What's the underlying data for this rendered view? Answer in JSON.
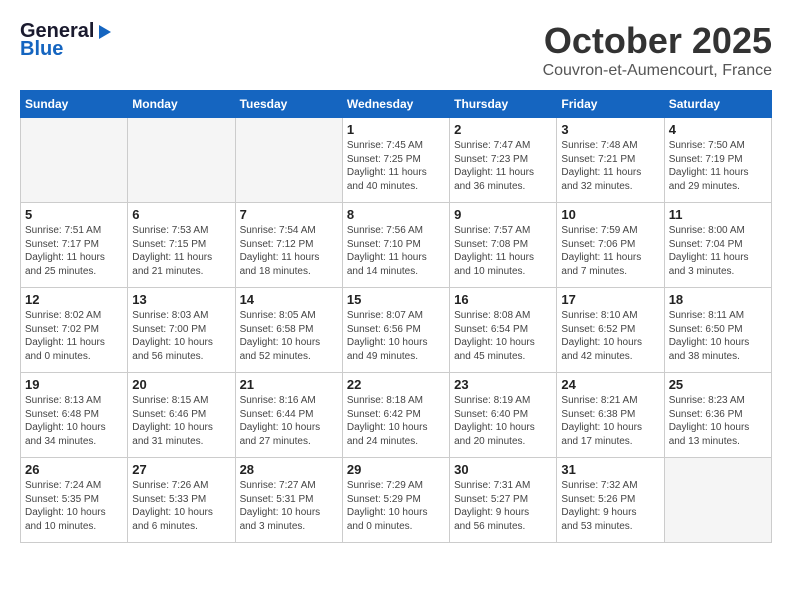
{
  "header": {
    "logo_general": "General",
    "logo_blue": "Blue",
    "month": "October 2025",
    "location": "Couvron-et-Aumencourt, France"
  },
  "weekdays": [
    "Sunday",
    "Monday",
    "Tuesday",
    "Wednesday",
    "Thursday",
    "Friday",
    "Saturday"
  ],
  "weeks": [
    [
      {
        "day": "",
        "info": ""
      },
      {
        "day": "",
        "info": ""
      },
      {
        "day": "",
        "info": ""
      },
      {
        "day": "1",
        "info": "Sunrise: 7:45 AM\nSunset: 7:25 PM\nDaylight: 11 hours\nand 40 minutes."
      },
      {
        "day": "2",
        "info": "Sunrise: 7:47 AM\nSunset: 7:23 PM\nDaylight: 11 hours\nand 36 minutes."
      },
      {
        "day": "3",
        "info": "Sunrise: 7:48 AM\nSunset: 7:21 PM\nDaylight: 11 hours\nand 32 minutes."
      },
      {
        "day": "4",
        "info": "Sunrise: 7:50 AM\nSunset: 7:19 PM\nDaylight: 11 hours\nand 29 minutes."
      }
    ],
    [
      {
        "day": "5",
        "info": "Sunrise: 7:51 AM\nSunset: 7:17 PM\nDaylight: 11 hours\nand 25 minutes."
      },
      {
        "day": "6",
        "info": "Sunrise: 7:53 AM\nSunset: 7:15 PM\nDaylight: 11 hours\nand 21 minutes."
      },
      {
        "day": "7",
        "info": "Sunrise: 7:54 AM\nSunset: 7:12 PM\nDaylight: 11 hours\nand 18 minutes."
      },
      {
        "day": "8",
        "info": "Sunrise: 7:56 AM\nSunset: 7:10 PM\nDaylight: 11 hours\nand 14 minutes."
      },
      {
        "day": "9",
        "info": "Sunrise: 7:57 AM\nSunset: 7:08 PM\nDaylight: 11 hours\nand 10 minutes."
      },
      {
        "day": "10",
        "info": "Sunrise: 7:59 AM\nSunset: 7:06 PM\nDaylight: 11 hours\nand 7 minutes."
      },
      {
        "day": "11",
        "info": "Sunrise: 8:00 AM\nSunset: 7:04 PM\nDaylight: 11 hours\nand 3 minutes."
      }
    ],
    [
      {
        "day": "12",
        "info": "Sunrise: 8:02 AM\nSunset: 7:02 PM\nDaylight: 11 hours\nand 0 minutes."
      },
      {
        "day": "13",
        "info": "Sunrise: 8:03 AM\nSunset: 7:00 PM\nDaylight: 10 hours\nand 56 minutes."
      },
      {
        "day": "14",
        "info": "Sunrise: 8:05 AM\nSunset: 6:58 PM\nDaylight: 10 hours\nand 52 minutes."
      },
      {
        "day": "15",
        "info": "Sunrise: 8:07 AM\nSunset: 6:56 PM\nDaylight: 10 hours\nand 49 minutes."
      },
      {
        "day": "16",
        "info": "Sunrise: 8:08 AM\nSunset: 6:54 PM\nDaylight: 10 hours\nand 45 minutes."
      },
      {
        "day": "17",
        "info": "Sunrise: 8:10 AM\nSunset: 6:52 PM\nDaylight: 10 hours\nand 42 minutes."
      },
      {
        "day": "18",
        "info": "Sunrise: 8:11 AM\nSunset: 6:50 PM\nDaylight: 10 hours\nand 38 minutes."
      }
    ],
    [
      {
        "day": "19",
        "info": "Sunrise: 8:13 AM\nSunset: 6:48 PM\nDaylight: 10 hours\nand 34 minutes."
      },
      {
        "day": "20",
        "info": "Sunrise: 8:15 AM\nSunset: 6:46 PM\nDaylight: 10 hours\nand 31 minutes."
      },
      {
        "day": "21",
        "info": "Sunrise: 8:16 AM\nSunset: 6:44 PM\nDaylight: 10 hours\nand 27 minutes."
      },
      {
        "day": "22",
        "info": "Sunrise: 8:18 AM\nSunset: 6:42 PM\nDaylight: 10 hours\nand 24 minutes."
      },
      {
        "day": "23",
        "info": "Sunrise: 8:19 AM\nSunset: 6:40 PM\nDaylight: 10 hours\nand 20 minutes."
      },
      {
        "day": "24",
        "info": "Sunrise: 8:21 AM\nSunset: 6:38 PM\nDaylight: 10 hours\nand 17 minutes."
      },
      {
        "day": "25",
        "info": "Sunrise: 8:23 AM\nSunset: 6:36 PM\nDaylight: 10 hours\nand 13 minutes."
      }
    ],
    [
      {
        "day": "26",
        "info": "Sunrise: 7:24 AM\nSunset: 5:35 PM\nDaylight: 10 hours\nand 10 minutes."
      },
      {
        "day": "27",
        "info": "Sunrise: 7:26 AM\nSunset: 5:33 PM\nDaylight: 10 hours\nand 6 minutes."
      },
      {
        "day": "28",
        "info": "Sunrise: 7:27 AM\nSunset: 5:31 PM\nDaylight: 10 hours\nand 3 minutes."
      },
      {
        "day": "29",
        "info": "Sunrise: 7:29 AM\nSunset: 5:29 PM\nDaylight: 10 hours\nand 0 minutes."
      },
      {
        "day": "30",
        "info": "Sunrise: 7:31 AM\nSunset: 5:27 PM\nDaylight: 9 hours\nand 56 minutes."
      },
      {
        "day": "31",
        "info": "Sunrise: 7:32 AM\nSunset: 5:26 PM\nDaylight: 9 hours\nand 53 minutes."
      },
      {
        "day": "",
        "info": ""
      }
    ]
  ]
}
